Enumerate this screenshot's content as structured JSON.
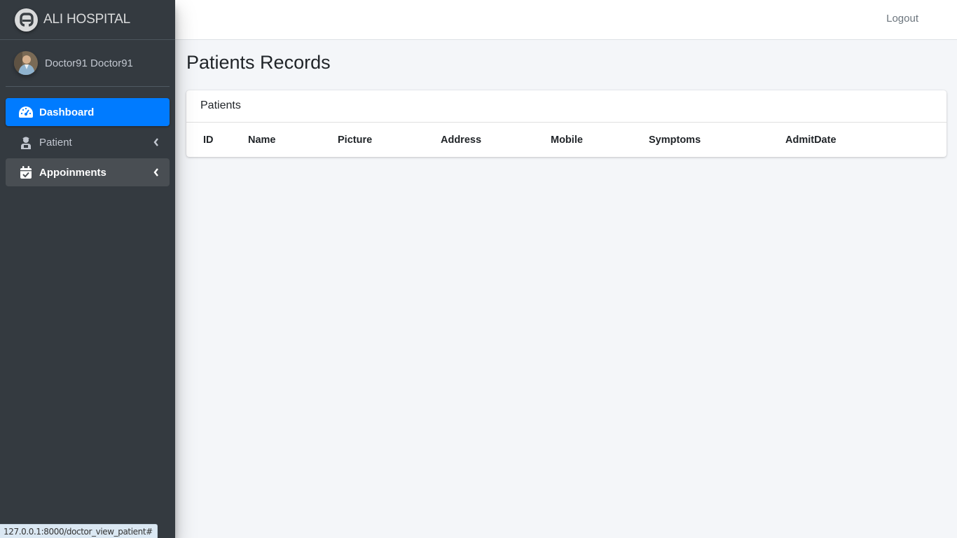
{
  "brand": {
    "name": "ALI HOSPITAL",
    "logo_icon": "logo-a-icon"
  },
  "user": {
    "name": "Doctor91 Doctor91"
  },
  "sidebar": {
    "items": [
      {
        "label": "Dashboard",
        "icon": "dashboard-gauge-icon",
        "state": "active"
      },
      {
        "label": "Patient",
        "icon": "user-injured-icon",
        "state": "collapsed"
      },
      {
        "label": "Appoinments",
        "icon": "calendar-check-icon",
        "state": "open"
      }
    ]
  },
  "topbar": {
    "logout_label": "Logout"
  },
  "page": {
    "title": "Patients Records"
  },
  "card": {
    "title": "Patients",
    "columns": [
      "ID",
      "Name",
      "Picture",
      "Address",
      "Mobile",
      "Symptoms",
      "AdmitDate"
    ],
    "rows": []
  },
  "status_bar": {
    "url": "127.0.0.1:8000/doctor_view_patient#"
  },
  "colors": {
    "sidebar_bg": "#343a40",
    "active_item": "#007bff",
    "content_bg": "#f4f6f9"
  }
}
